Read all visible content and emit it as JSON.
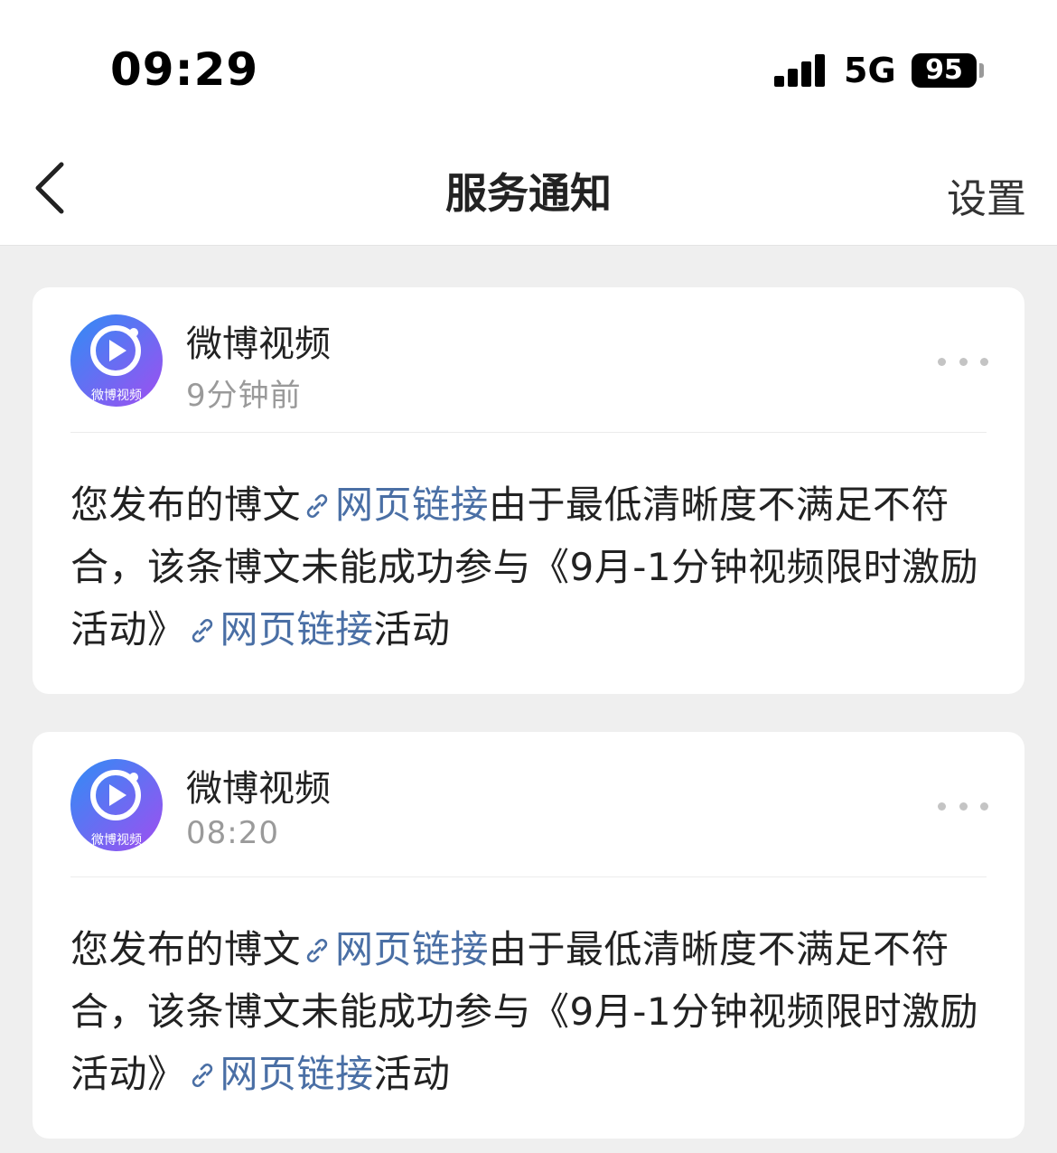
{
  "status_bar": {
    "time": "09:29",
    "network": "5G",
    "battery": "95"
  },
  "nav": {
    "back_icon": "chevron-left-icon",
    "title": "服务通知",
    "settings_label": "设置"
  },
  "notifications": [
    {
      "sender": "微博视频",
      "avatar_label": "微博视频",
      "time": "9分钟前",
      "text_1": "您发布的博文",
      "link_1": "网页链接",
      "text_2": "由于最低清晰度不满足不符合，该条博文未能成功参与《9月-1分钟视频限时激励活动》",
      "link_2": "网页链接",
      "text_3": "活动"
    },
    {
      "sender": "微博视频",
      "avatar_label": "微博视频",
      "time": "08:20",
      "text_1": "您发布的博文",
      "link_1": "网页链接",
      "text_2": "由于最低清晰度不满足不符合，该条博文未能成功参与《9月-1分钟视频限时激励活动》",
      "link_2": "网页链接",
      "text_3": "活动"
    }
  ],
  "colors": {
    "link": "#4a6fa5",
    "background": "#efefef",
    "avatar_gradient_start": "#2f8df5",
    "avatar_gradient_end": "#a04ef0"
  }
}
